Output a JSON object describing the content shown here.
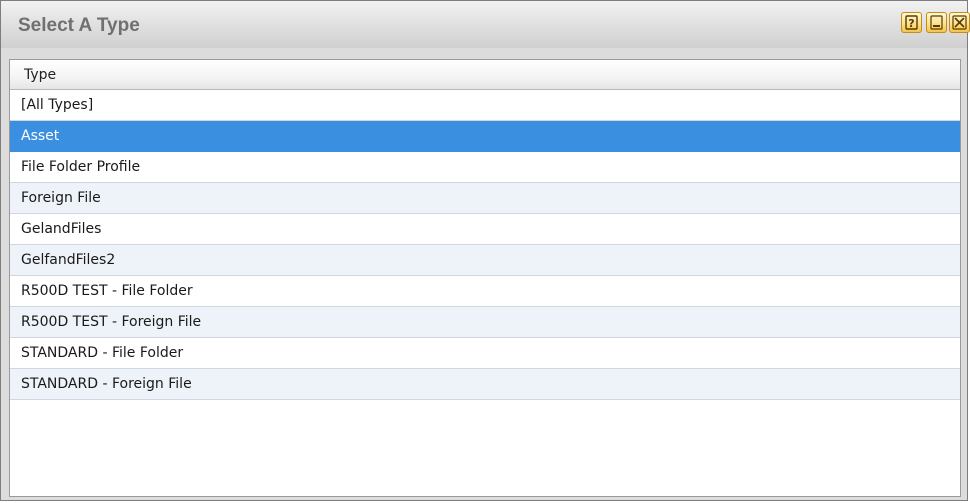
{
  "window": {
    "title": "Select A Type",
    "controls": {
      "help_icon": "help-icon",
      "minimize_icon": "minimize-icon",
      "close_icon": "close-icon",
      "accent_color": "#f3c54a"
    }
  },
  "grid": {
    "column_header": "Type",
    "selected_color": "#3b8fe1",
    "alt_row_color": "#eef3fa",
    "rows": [
      {
        "label": "[All Types]",
        "selected": false
      },
      {
        "label": "Asset",
        "selected": true
      },
      {
        "label": "File Folder Profile",
        "selected": false
      },
      {
        "label": "Foreign File",
        "selected": false
      },
      {
        "label": "GelandFiles",
        "selected": false
      },
      {
        "label": "GelfandFiles2",
        "selected": false
      },
      {
        "label": "R500D TEST - File Folder",
        "selected": false
      },
      {
        "label": "R500D TEST - Foreign File",
        "selected": false
      },
      {
        "label": "STANDARD - File Folder",
        "selected": false
      },
      {
        "label": "STANDARD - Foreign File",
        "selected": false
      }
    ]
  }
}
